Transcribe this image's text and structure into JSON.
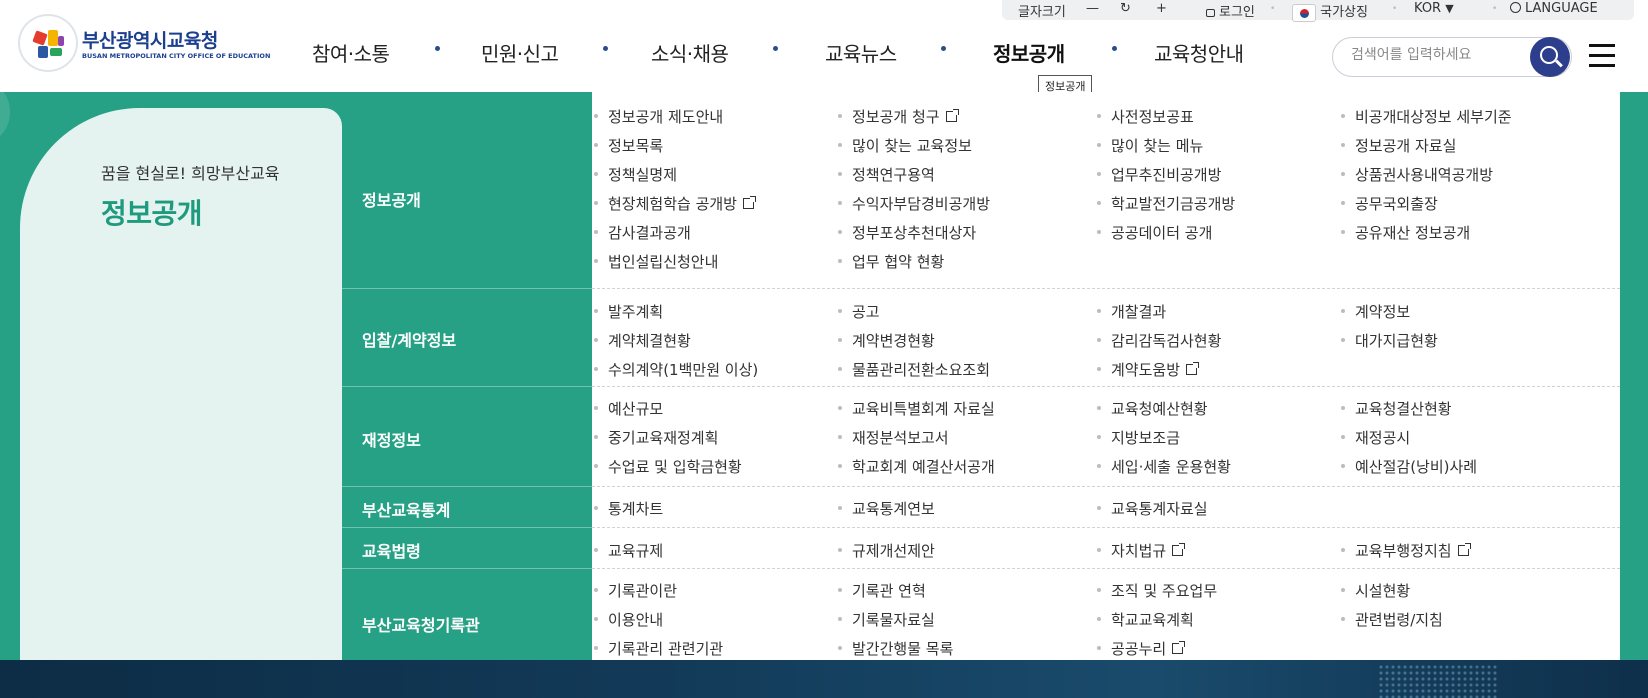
{
  "util": {
    "font_size_label": "글자크기",
    "minus": "—",
    "refresh": "↻",
    "plus": "+",
    "login": "로그인",
    "national_symbol": "국가상징",
    "lang_current": "KOR",
    "lang_arrow": "▼",
    "language": "LANGUAGE"
  },
  "logo": {
    "title": "부산광역시교육청",
    "subtitle": "BUSAN METROPOLITAN CITY OFFICE OF EDUCATION"
  },
  "gnb": [
    {
      "label": "참여·소통"
    },
    {
      "label": "민원·신고"
    },
    {
      "label": "소식·채용"
    },
    {
      "label": "교육뉴스"
    },
    {
      "label": "정보공개"
    },
    {
      "label": "교육청안내"
    }
  ],
  "tooltip": "정보공개",
  "search": {
    "placeholder": "검색어를 입력하세요"
  },
  "panel": {
    "slogan": "꿈을 현실로! 희망부산교육",
    "title": "정보공개"
  },
  "categories": [
    {
      "label": "정보공개"
    },
    {
      "label": "입찰/계약정보"
    },
    {
      "label": "재정정보"
    },
    {
      "label": "부산교육통계"
    },
    {
      "label": "교육법령"
    },
    {
      "label": "부산교육청기록관"
    }
  ],
  "groups": [
    {
      "links": [
        {
          "label": "정보공개 제도안내"
        },
        {
          "label": "정보공개 청구",
          "ext": true
        },
        {
          "label": "사전정보공표"
        },
        {
          "label": "비공개대상정보 세부기준"
        },
        {
          "label": "정보목록"
        },
        {
          "label": "많이 찾는 교육정보"
        },
        {
          "label": "많이 찾는 메뉴"
        },
        {
          "label": "정보공개 자료실"
        },
        {
          "label": "정책실명제"
        },
        {
          "label": "정책연구용역"
        },
        {
          "label": "업무추진비공개방"
        },
        {
          "label": "상품권사용내역공개방"
        },
        {
          "label": "현장체험학습 공개방",
          "ext": true
        },
        {
          "label": "수익자부담경비공개방"
        },
        {
          "label": "학교발전기금공개방"
        },
        {
          "label": "공무국외출장"
        },
        {
          "label": "감사결과공개"
        },
        {
          "label": "정부포상추천대상자"
        },
        {
          "label": "공공데이터 공개"
        },
        {
          "label": "공유재산 정보공개"
        },
        {
          "label": "법인설립신청안내"
        },
        {
          "label": "업무 협약 현황"
        }
      ]
    },
    {
      "links": [
        {
          "label": "발주계획"
        },
        {
          "label": "공고"
        },
        {
          "label": "개찰결과"
        },
        {
          "label": "계약정보"
        },
        {
          "label": "계약체결현황"
        },
        {
          "label": "계약변경현황"
        },
        {
          "label": "감리감독검사현황"
        },
        {
          "label": "대가지급현황"
        },
        {
          "label": "수의계약(1백만원 이상)"
        },
        {
          "label": "물품관리전환소요조회"
        },
        {
          "label": "계약도움방",
          "ext": true
        }
      ]
    },
    {
      "links": [
        {
          "label": "예산규모"
        },
        {
          "label": "교육비특별회계 자료실"
        },
        {
          "label": "교육청예산현황"
        },
        {
          "label": "교육청결산현황"
        },
        {
          "label": "중기교육재정계획"
        },
        {
          "label": "재정분석보고서"
        },
        {
          "label": "지방보조금"
        },
        {
          "label": "재정공시"
        },
        {
          "label": "수업료 및 입학금현황"
        },
        {
          "label": "학교회계 예결산서공개"
        },
        {
          "label": "세입·세출 운용현황"
        },
        {
          "label": "예산절감(낭비)사례"
        }
      ]
    },
    {
      "links": [
        {
          "label": "통계차트"
        },
        {
          "label": "교육통계연보"
        },
        {
          "label": "교육통계자료실"
        }
      ]
    },
    {
      "links": [
        {
          "label": "교육규제"
        },
        {
          "label": "규제개선제안"
        },
        {
          "label": "자치법규",
          "ext": true
        },
        {
          "label": "교육부행정지침",
          "ext": true
        }
      ]
    },
    {
      "links": [
        {
          "label": "기록관이란"
        },
        {
          "label": "기록관 연혁"
        },
        {
          "label": "조직 및 주요업무"
        },
        {
          "label": "시설현황"
        },
        {
          "label": "이용안내"
        },
        {
          "label": "기록물자료실"
        },
        {
          "label": "학교교육계획"
        },
        {
          "label": "관련법령/지침"
        },
        {
          "label": "기록관리 관련기관"
        },
        {
          "label": "발간간행물 목록"
        },
        {
          "label": "공공누리",
          "ext": true
        }
      ]
    }
  ],
  "colors": {
    "accent_green": "#26a185",
    "panel_bg": "#e4f3ef",
    "brand_navy": "#2d3e8c"
  }
}
